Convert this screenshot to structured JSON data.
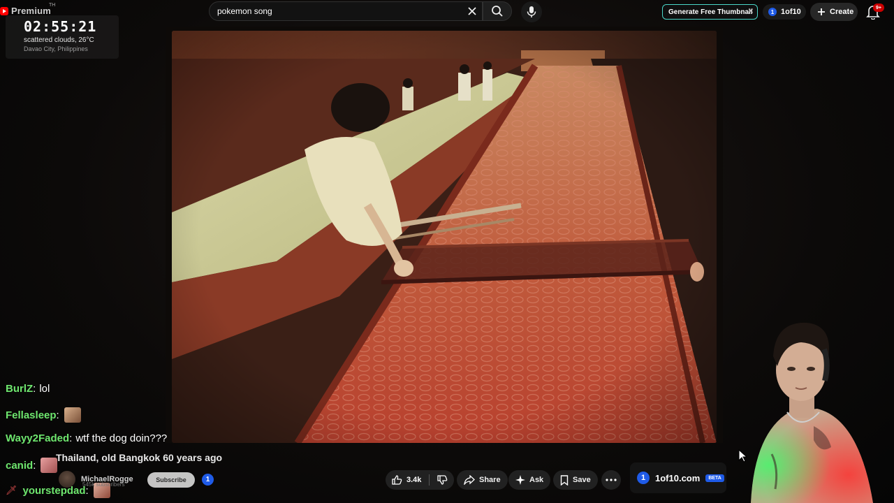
{
  "header": {
    "logo_text": "Premium",
    "region_code": "TH",
    "search_value": "pokemon song",
    "generate_thumbnail_label": "Generate Free Thumbnail",
    "oneof_label": "1of10",
    "oneof_dot": "1",
    "create_label": "Create",
    "notifications_badge": "9+"
  },
  "clock_widget": {
    "time": "02:55:21",
    "weather": "scattered clouds, 26°C",
    "location": "Davao City, Philippines"
  },
  "chat": {
    "messages": [
      {
        "user": "BurlZ",
        "text": "lol"
      },
      {
        "user": "Fellasleep",
        "text": ""
      },
      {
        "user": "Wayy2Faded",
        "text": "wtf the dog doin???"
      },
      {
        "user": "canid",
        "text": ""
      },
      {
        "user": "yourstepdad",
        "text": ""
      }
    ]
  },
  "video": {
    "title": "Thailand, old Bangkok 60 years ago",
    "channel_name": "MichaelRogge",
    "channel_subs": "545k subscribers",
    "subscribe_label": "Subscribe",
    "badge_dot": "1"
  },
  "actions": {
    "like_count": "3.4k",
    "share_label": "Share",
    "ask_label": "Ask",
    "save_label": "Save"
  },
  "extension": {
    "name": "1of10.com",
    "badge": "BETA",
    "dot": "1"
  },
  "colors": {
    "chat_username": "#6ee66e",
    "brand_red": "#ff0000",
    "extension_blue": "#1f5be8",
    "thumbnail_border": "#4ad7c8"
  }
}
